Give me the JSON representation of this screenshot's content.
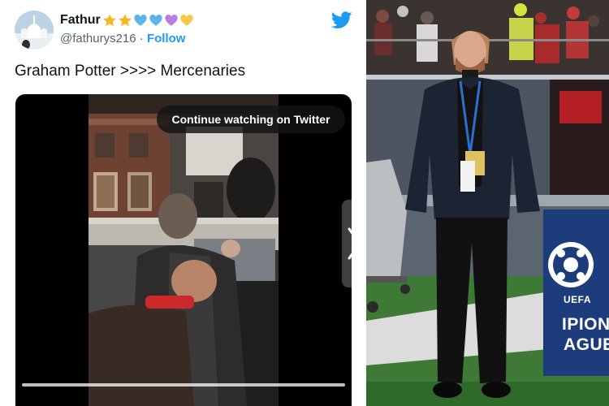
{
  "tweet": {
    "user_name": "Fathur",
    "name_emojis": [
      {
        "icon": "star-emoji",
        "color": "#f5b820"
      },
      {
        "icon": "star-emoji",
        "color": "#f5b820"
      },
      {
        "icon": "blue-heart-emoji",
        "color": "#5cb4ec"
      },
      {
        "icon": "blue-heart-emoji",
        "color": "#5cb4ec"
      },
      {
        "icon": "purple-heart-emoji",
        "color": "#b57ee0"
      },
      {
        "icon": "yellow-heart-emoji",
        "color": "#f5c84a"
      }
    ],
    "handle": "@fathurys216",
    "separator": "·",
    "follow_label": "Follow",
    "text": "Graham Potter >>>> Mercenaries",
    "video": {
      "overlay_label": "Continue watching on Twitter"
    }
  },
  "photo": {
    "board_lines": [
      "UEFA",
      "IPION",
      "AGUE"
    ]
  },
  "colors": {
    "twitter_blue": "#1d9bf0",
    "text_primary": "#0f1419",
    "text_secondary": "#536471"
  }
}
